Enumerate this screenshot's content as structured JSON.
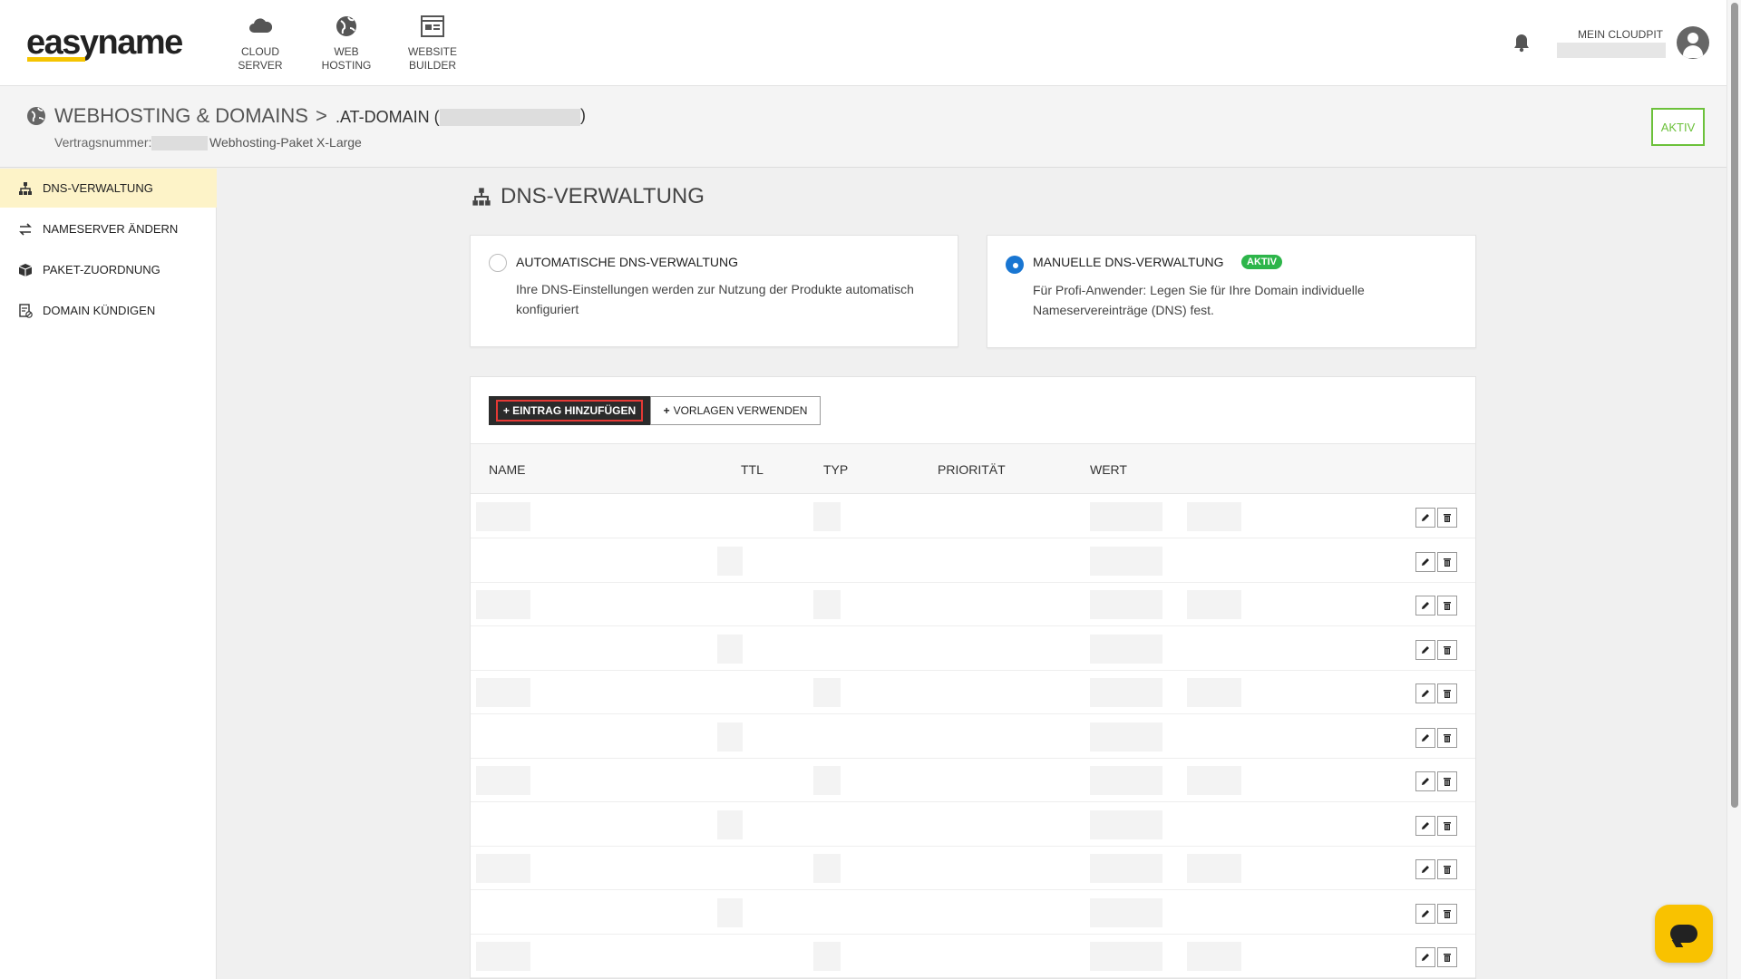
{
  "brand": {
    "name": "easyname",
    "accent": "#f5c400"
  },
  "topnav": [
    {
      "line1": "CLOUD",
      "line2": "SERVER",
      "icon": "cloud-icon"
    },
    {
      "line1": "WEB",
      "line2": "HOSTING",
      "icon": "globe-icon"
    },
    {
      "line1": "WEBSITE",
      "line2": "BUILDER",
      "icon": "website-builder-icon"
    }
  ],
  "account": {
    "label": "MEIN CLOUDPIT"
  },
  "header": {
    "title": "WEBHOSTING & DOMAINS",
    "separator": ">",
    "subtitle": ".AT-DOMAIN (",
    "subtitle_close": ")",
    "contract_label": "Vertragsnummer:",
    "package": "Webhosting-Paket X-Large",
    "status": "AKTIV"
  },
  "sidebar": {
    "items": [
      {
        "label": "DNS-VERWALTUNG",
        "icon": "sitemap-icon",
        "active": true
      },
      {
        "label": "NAMESERVER ÄNDERN",
        "icon": "exchange-icon",
        "active": false
      },
      {
        "label": "PAKET-ZUORDNUNG",
        "icon": "cube-icon",
        "active": false
      },
      {
        "label": "DOMAIN KÜNDIGEN",
        "icon": "cancel-document-icon",
        "active": false
      }
    ]
  },
  "main": {
    "title": "DNS-VERWALTUNG",
    "options": [
      {
        "title": "AUTOMATISCHE DNS-VERWALTUNG",
        "desc_line1": "Ihre DNS-Einstellungen werden zur Nutzung der Produkte automatisch",
        "desc_line2": "konfiguriert",
        "selected": false
      },
      {
        "title": "MANUELLE DNS-VERWALTUNG",
        "badge": "AKTIV",
        "desc_line1": "Für Profi-Anwender: Legen Sie für Ihre Domain individuelle",
        "desc_line2": "Nameservereinträge (DNS) fest.",
        "selected": true
      }
    ],
    "buttons": {
      "add_entry": "EINTRAG HINZUFÜGEN",
      "use_templates": "VORLAGEN VERWENDEN"
    },
    "table": {
      "columns": [
        "NAME",
        "TTL",
        "TYP",
        "PRIORITÄT",
        "WERT"
      ],
      "row_count": 11
    }
  },
  "colors": {
    "active_green": "#6cc13b",
    "badge_green": "#2db54a",
    "radio_blue": "#1976d2",
    "highlight_red": "#e53935",
    "chat_yellow": "#f9c200"
  }
}
